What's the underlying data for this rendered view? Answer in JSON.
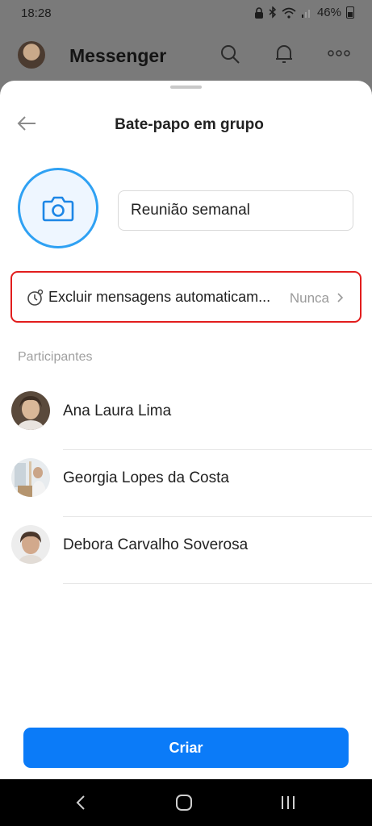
{
  "status_bar": {
    "time": "18:28",
    "battery": "46%"
  },
  "background_header": {
    "title": "Messenger"
  },
  "sheet": {
    "title": "Bate-papo em grupo",
    "group_name_value": "Reunião semanal",
    "auto_delete": {
      "label": "Excluir mensagens automaticam...",
      "value": "Nunca"
    },
    "participants_label": "Participantes",
    "participants": [
      {
        "name": "Ana Laura Lima"
      },
      {
        "name": "Georgia Lopes da Costa"
      },
      {
        "name": "Debora Carvalho Soverosa"
      }
    ],
    "create_label": "Criar"
  },
  "colors": {
    "accent": "#0b7bf8",
    "highlight_border": "#e21d1d",
    "camera_ring": "#2fa1f3"
  },
  "icons": [
    "back-arrow-icon",
    "camera-icon",
    "timer-icon",
    "chevron-right-icon",
    "search-icon",
    "bell-icon",
    "more-icon",
    "nav-back-icon",
    "nav-home-icon",
    "nav-recents-icon"
  ]
}
